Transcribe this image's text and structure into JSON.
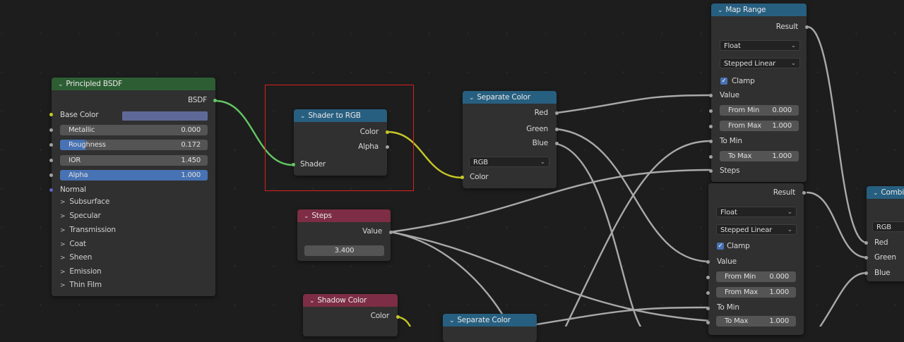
{
  "nodes": {
    "principled": {
      "title": "Principled BSDF",
      "output": "BSDF",
      "base_color_label": "Base Color",
      "metallic": {
        "label": "Metallic",
        "value": "0.000"
      },
      "roughness": {
        "label": "Roughness",
        "value": "0.172",
        "fraction": 0.172
      },
      "ior": {
        "label": "IOR",
        "value": "1.450"
      },
      "alpha": {
        "label": "Alpha",
        "value": "1.000",
        "fraction": 1.0
      },
      "normal_label": "Normal",
      "panels": [
        "Subsurface",
        "Specular",
        "Transmission",
        "Coat",
        "Sheen",
        "Emission",
        "Thin Film"
      ]
    },
    "shader_to_rgb": {
      "title": "Shader to RGB",
      "out_color": "Color",
      "out_alpha": "Alpha",
      "in_shader": "Shader"
    },
    "separate_color": {
      "title": "Separate Color",
      "out_red": "Red",
      "out_green": "Green",
      "out_blue": "Blue",
      "mode": "RGB",
      "in_color": "Color"
    },
    "steps": {
      "title": "Steps",
      "output": "Value",
      "value": "3.400"
    },
    "shadow_color": {
      "title": "Shadow Color",
      "output": "Color"
    },
    "separate_color_2": {
      "title": "Separate Color"
    },
    "map_range_1": {
      "title": "Map Range",
      "result": "Result",
      "data_type": "Float",
      "interpolation": "Stepped Linear",
      "clamp": "Clamp",
      "value_label": "Value",
      "from_min": {
        "label": "From Min",
        "value": "0.000"
      },
      "from_max": {
        "label": "From Max",
        "value": "1.000"
      },
      "to_min_label": "To Min",
      "to_max": {
        "label": "To Max",
        "value": "1.000"
      },
      "steps_label": "Steps"
    },
    "map_range_2": {
      "result": "Result",
      "data_type": "Float",
      "interpolation": "Stepped Linear",
      "clamp": "Clamp",
      "value_label": "Value",
      "from_min": {
        "label": "From Min",
        "value": "0.000"
      },
      "from_max": {
        "label": "From Max",
        "value": "1.000"
      },
      "to_min_label": "To Min",
      "to_max": {
        "label": "To Max",
        "value": "1.000"
      }
    },
    "combine": {
      "title": "Combi",
      "mode": "RGB",
      "in_red": "Red",
      "in_green": "Green",
      "in_blue": "Blue"
    }
  },
  "colors": {
    "shader_header": "#2d5e33",
    "converter_header": "#275f80",
    "input_header": "#7d2d45",
    "color_socket": "#c7c729",
    "shader_socket": "#63c763",
    "vector_socket": "#6363c7",
    "float_socket": "#a1a1a1",
    "field_accent": "#4772b3",
    "selection_box": "#d92020"
  }
}
